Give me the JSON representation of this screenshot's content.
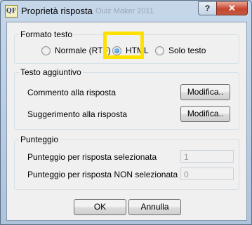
{
  "window": {
    "title": "Proprietà risposta",
    "title_ghost": "Ouiz Maker 2011",
    "app_icon_text": "QF",
    "help_label": "?",
    "close_label": "✕"
  },
  "format_group": {
    "label": "Formato testo",
    "options": [
      {
        "label": "Normale (RTF)",
        "checked": false
      },
      {
        "label": "HTML",
        "checked": true
      },
      {
        "label": "Solo testo",
        "checked": false
      }
    ]
  },
  "extra_group": {
    "label": "Testo aggiuntivo",
    "rows": [
      {
        "label": "Commento alla risposta",
        "button": "Modifica.."
      },
      {
        "label": "Suggerimento alla risposta",
        "button": "Modifica.."
      }
    ]
  },
  "score_group": {
    "label": "Punteggio",
    "rows": [
      {
        "label": "Punteggio per risposta selezionata",
        "value": "1"
      },
      {
        "label": "Punteggio per risposta NON selezionata",
        "value": "0"
      }
    ]
  },
  "footer": {
    "ok_label": "OK",
    "cancel_label": "Annulla"
  },
  "colors": {
    "highlight": "#ffe100",
    "close_button": "#c7442f"
  }
}
